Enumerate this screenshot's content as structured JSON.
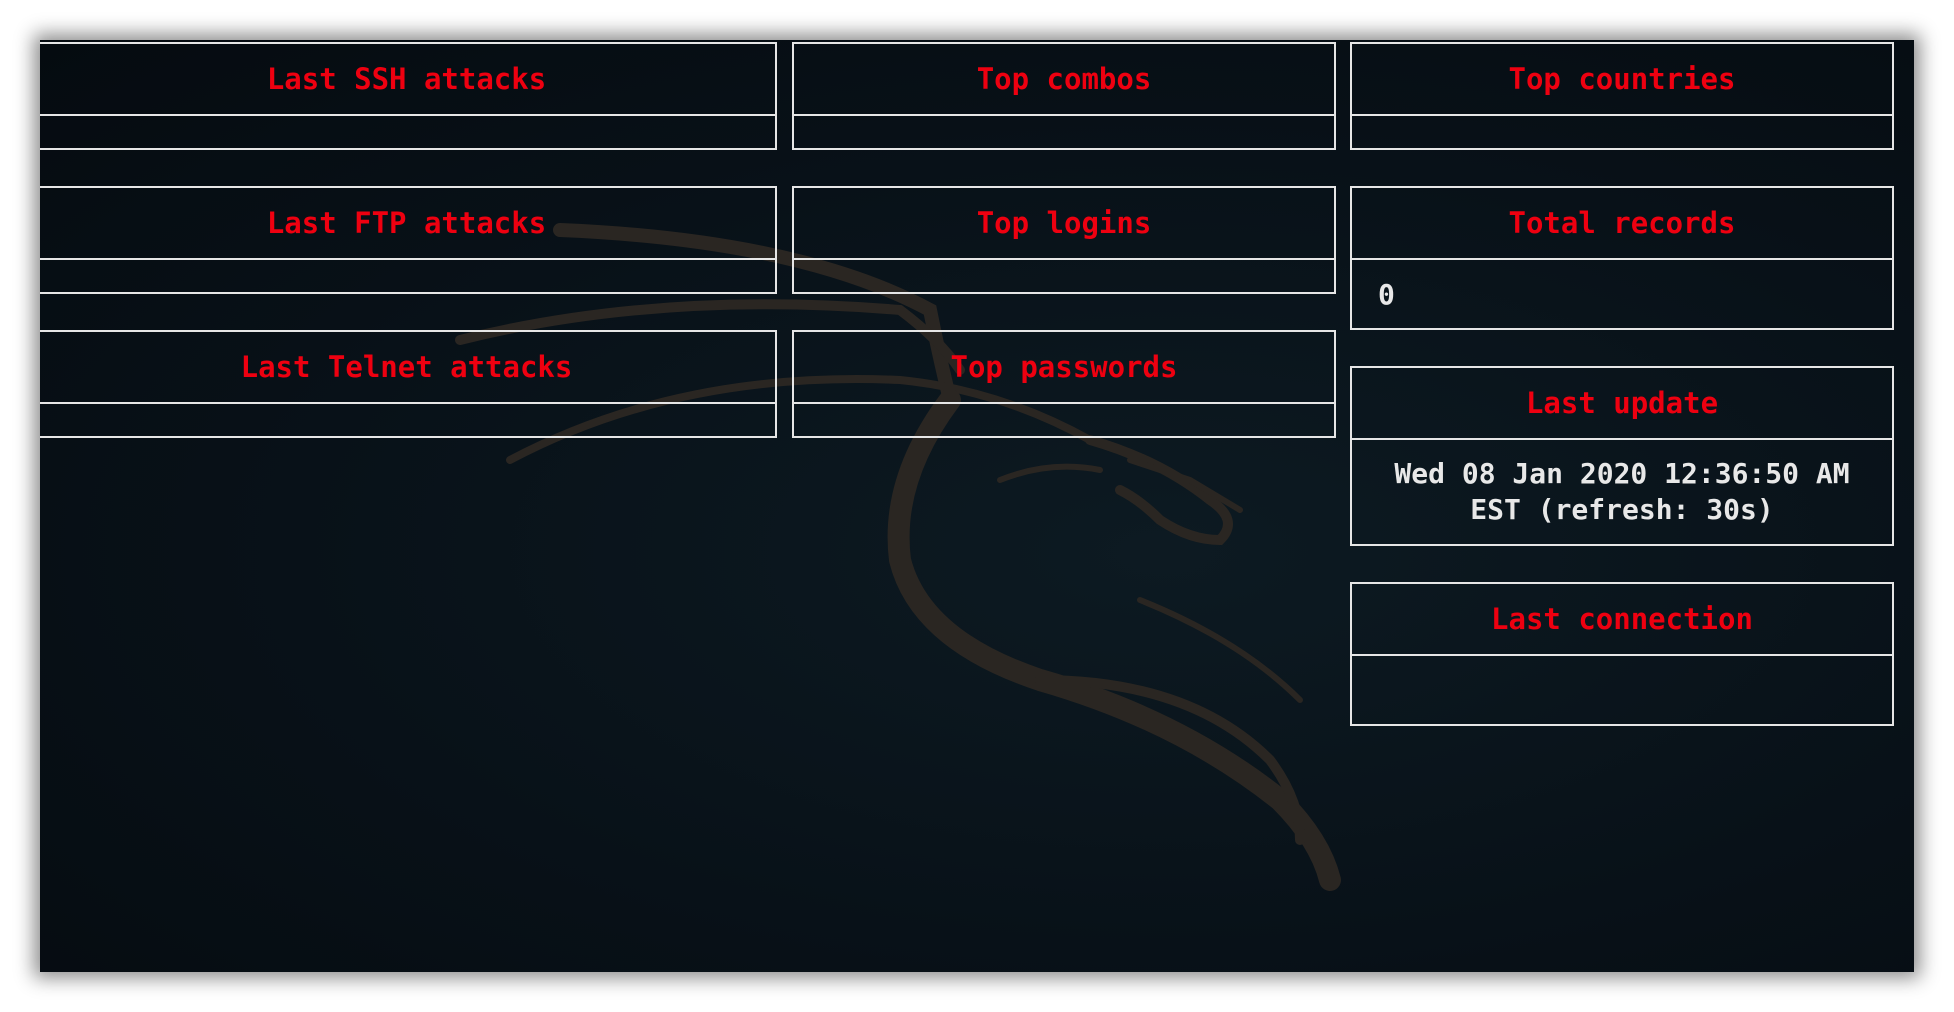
{
  "panels": {
    "last_ssh": {
      "title": "Last SSH attacks"
    },
    "top_combos": {
      "title": "Top combos"
    },
    "top_countries": {
      "title": "Top countries"
    },
    "last_ftp": {
      "title": "Last FTP attacks"
    },
    "top_logins": {
      "title": "Top logins"
    },
    "total_records": {
      "title": "Total records",
      "value": "0"
    },
    "last_telnet": {
      "title": "Last Telnet attacks"
    },
    "top_passwords": {
      "title": "Top passwords"
    },
    "last_update": {
      "title": "Last update",
      "value": "Wed 08 Jan 2020 12:36:50 AM EST (refresh: 30s)"
    },
    "last_connection": {
      "title": "Last connection"
    }
  },
  "colors": {
    "title_red": "#ee0010",
    "border": "#e6e6e6",
    "value_text": "#e8e8e8",
    "background": "#081118"
  },
  "icons": {
    "background_logo": "kali-dragon-icon"
  }
}
